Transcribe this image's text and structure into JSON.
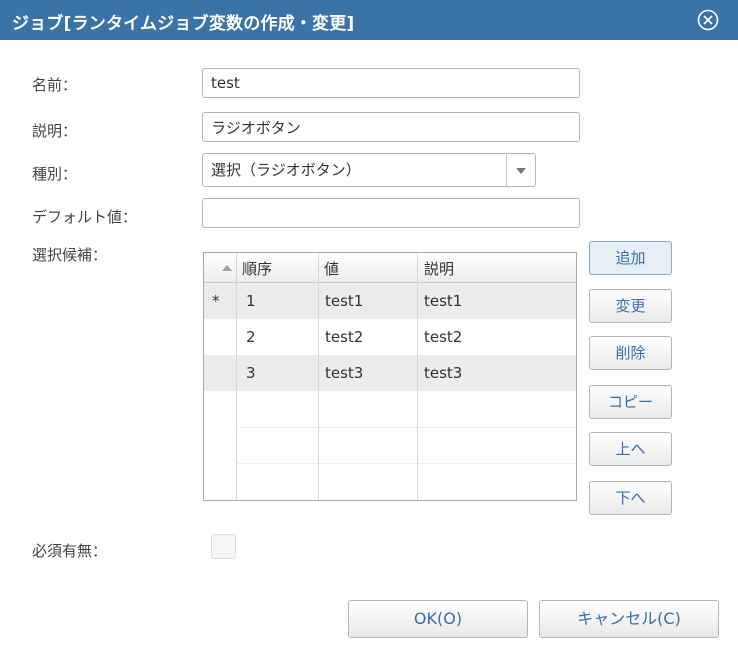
{
  "dialog": {
    "title": "ジョブ[ランタイムジョブ変数の作成・変更]",
    "close_icon": "close-circle-icon"
  },
  "form": {
    "name_label": "名前：",
    "name_value": "test",
    "description_label": "説明：",
    "description_value": "ラジオボタン",
    "type_label": "種別：",
    "type_value": "選択（ラジオボタン）",
    "default_label": "デフォルト値：",
    "default_value": "",
    "candidates_label": "選択候補：",
    "required_label": "必須有無：",
    "required_checked": false
  },
  "table": {
    "columns": [
      "順序",
      "値",
      "説明"
    ],
    "rows": [
      {
        "marker": "*",
        "order": "1",
        "value": "test1",
        "description": "test1"
      },
      {
        "marker": "",
        "order": "2",
        "value": "test2",
        "description": "test2"
      },
      {
        "marker": "",
        "order": "3",
        "value": "test3",
        "description": "test3"
      }
    ]
  },
  "side_buttons": {
    "add": "追加",
    "modify": "変更",
    "delete": "削除",
    "copy": "コピー",
    "up": "上へ",
    "down": "下へ"
  },
  "footer": {
    "ok": "OK(O)",
    "cancel": "キャンセル(C)"
  },
  "colors": {
    "titlebar": "#3a73a8",
    "button_text": "#3a6ea5",
    "row_alt": "#ececec"
  }
}
